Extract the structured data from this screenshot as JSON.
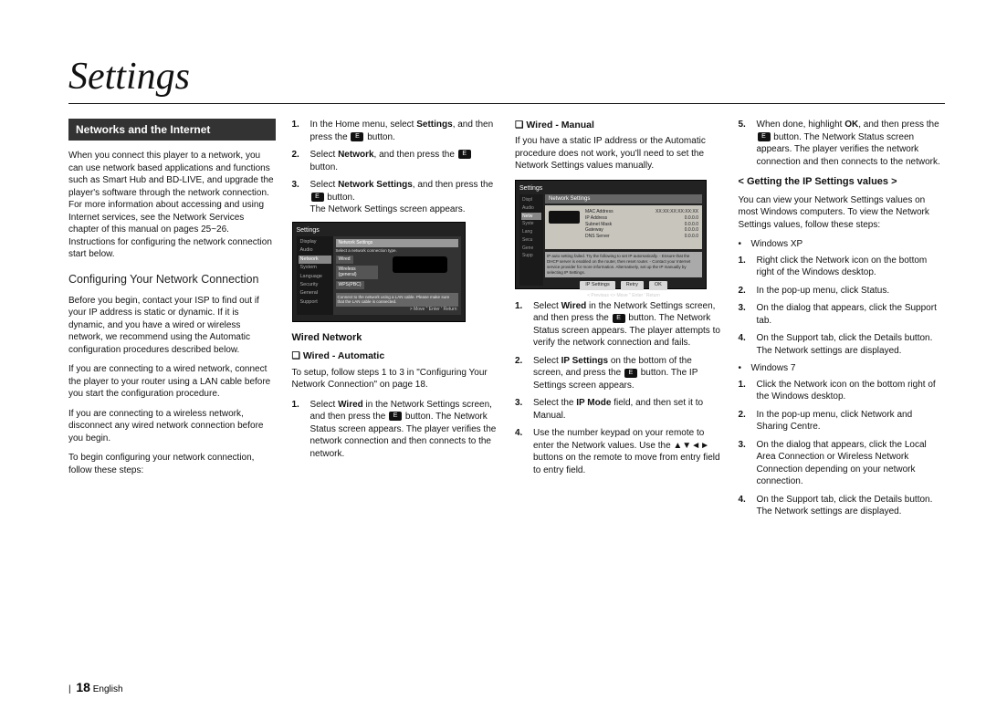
{
  "page_title": "Settings",
  "section_banner": "Networks and the Internet",
  "col1": {
    "intro": "When you connect this player to a network, you can use network based applications and functions such as Smart Hub and BD-LIVE, and upgrade the player's software through the network connection. For more information about accessing and using Internet services, see the Network Services chapter of this manual on pages 25~26. Instructions for configuring the network connection start below.",
    "subhead": "Configuring Your Network Connection",
    "p1": "Before you begin, contact your ISP to find out if your IP address is static or dynamic. If it is dynamic, and you have a wired or wireless network, we recommend using the Automatic configuration procedures described below.",
    "p2": "If you are connecting to a wired network, connect the player to your router using a LAN cable before you start the configuration procedure.",
    "p3": "If you are connecting to a wireless network, disconnect any wired network connection before you begin.",
    "p4": "To begin configuring your network connection, follow these steps:"
  },
  "col2": {
    "steps_a": [
      {
        "n": "1.",
        "t1": "In the Home menu, select ",
        "b": "Settings",
        "t2": ", and then press the ",
        "t3": " button."
      },
      {
        "n": "2.",
        "t1": "Select ",
        "b": "Network",
        "t2": ", and then press the ",
        "t3": " button."
      },
      {
        "n": "3.",
        "t1": "Select ",
        "b": "Network Settings",
        "t2": ", and then press the ",
        "t3": " button."
      }
    ],
    "step3_note": "The Network Settings screen appears.",
    "ss1": {
      "title": "Settings",
      "panel_title": "Network Settings",
      "hint_top": "Select a network connection type.",
      "menu": [
        "Display",
        "Audio",
        "Network",
        "System",
        "Language",
        "Security",
        "General",
        "Support"
      ],
      "options": [
        "Wired",
        "Wireless (general)",
        "WPS(PBC)"
      ],
      "hint": "Connect to the network using a LAN cable. Please make sure that the LAN cable is connected.",
      "footer": "> Move   \" Enter   ' Return"
    },
    "h4": "Wired Network",
    "h5a": "❏ Wired - Automatic",
    "auto_intro": "To setup, follow steps 1 to 3 in \"Configuring Your Network Connection\" on page 18.",
    "auto_step": {
      "n": "1.",
      "t1": "Select ",
      "b": "Wired",
      "t2": " in the Network Settings screen, and then press the ",
      "t3": " button. The Network Status screen appears. The player verifies the network connection and then connects to the network."
    }
  },
  "col3": {
    "h5b": "❏ Wired - Manual",
    "manual_intro": "If you have a static IP address or the Automatic procedure does not work, you'll need to set the Network Settings values manually.",
    "ss2": {
      "title": "Settings",
      "panel_title": "Network Settings",
      "menu": [
        "Displ",
        "Audio",
        "Netw",
        "Syste",
        "Lang",
        "Secu",
        "Gene",
        "Supp"
      ],
      "rows": [
        {
          "k": "MAC Address",
          "v": "XX:XX:XX:XX:XX:XX"
        },
        {
          "k": "IP Address",
          "v": "0.0.0.0"
        },
        {
          "k": "Subnet Mask",
          "v": "0.0.0.0"
        },
        {
          "k": "Gateway",
          "v": "0.0.0.0"
        },
        {
          "k": "DNS Server",
          "v": "0.0.0.0"
        }
      ],
      "msg": "IP auto setting failed. Try the following to set IP automatically. - Ensure that the DHCP server is enabled on the router, then reset router. - Contact your Internet service provider for more information. Alternatively, set up the IP manually by selecting IP Settings.",
      "btns": [
        "IP Settings",
        "Retry",
        "OK"
      ],
      "footer": "< Previous   <> Move   \" Enter   ' Return"
    },
    "steps": [
      {
        "n": "1.",
        "t1": "Select ",
        "b": "Wired",
        "t2": " in the Network Settings screen, and then press the ",
        "t3": " button. The Network Status screen appears. The player attempts to verify the network connection and fails."
      },
      {
        "n": "2.",
        "t1": "Select ",
        "b": "IP Settings",
        "t2": " on the bottom of the screen, and press the ",
        "t3": " button. The IP Settings screen appears."
      },
      {
        "n": "3.",
        "t1": "Select the ",
        "b": "IP Mode",
        "t2": " field, and then set it to Manual."
      },
      {
        "n": "4.",
        "t1": "Use the number keypad on your remote to enter the Network values. Use the ▲▼◄► buttons on the remote to move from entry field to entry field."
      }
    ]
  },
  "col4": {
    "step5": {
      "n": "5.",
      "t1": "When done, highlight ",
      "b": "OK",
      "t2": ", and then press the ",
      "t3": " button. The Network Status screen appears. The player verifies the network connection and then connects to the network."
    },
    "angle_head": "< Getting the IP Settings values >",
    "intro": "You can view your Network Settings values on most Windows computers. To view the Network Settings values, follow these steps:",
    "xp_label": "Windows XP",
    "xp_steps": [
      {
        "n": "1.",
        "t": "Right click the Network icon on the bottom right of the Windows desktop."
      },
      {
        "n": "2.",
        "t": "In the pop-up menu, click Status."
      },
      {
        "n": "3.",
        "t": "On the dialog that appears, click the Support tab."
      },
      {
        "n": "4.",
        "t": "On the Support tab, click the Details button."
      }
    ],
    "xp_note": "The Network settings are displayed.",
    "w7_label": "Windows 7",
    "w7_steps": [
      {
        "n": "1.",
        "t": "Click the Network icon on the bottom right of the Windows desktop."
      },
      {
        "n": "2.",
        "t": "In the pop-up menu, click Network and Sharing Centre."
      },
      {
        "n": "3.",
        "t": "On the dialog that appears, click the Local Area Connection or Wireless Network Connection depending on your network connection."
      },
      {
        "n": "4.",
        "t": "On the Support tab, click the Details button."
      }
    ],
    "w7_note": "The Network settings are displayed."
  },
  "footer": {
    "page": "18",
    "lang": "English"
  }
}
